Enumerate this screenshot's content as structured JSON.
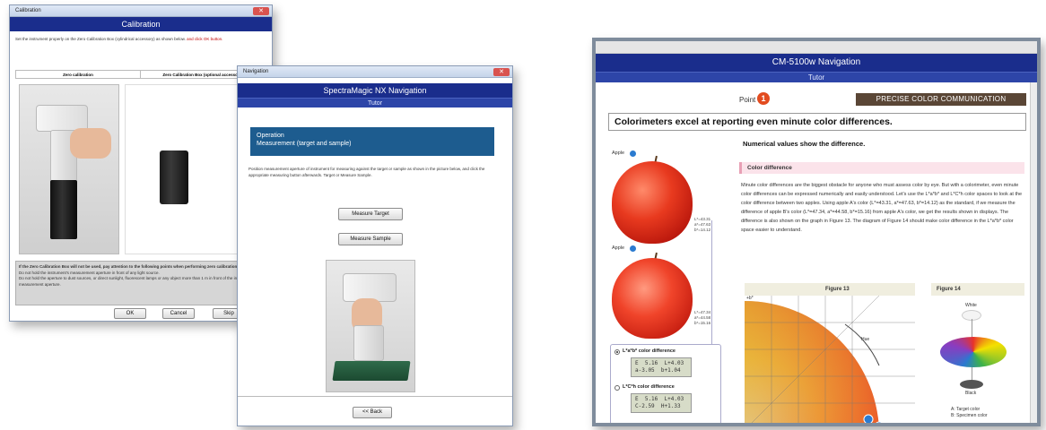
{
  "calibration_window": {
    "title_bar": "Calibration",
    "banner": "Calibration",
    "instruction": "Set the instrument properly on the Zero Calibration Box (cylindrical accessory) as shown below.",
    "instruction_red": "and click OK button.",
    "col_headers": [
      "Zero calibration",
      "Zero Calibration Box (optional accessory)"
    ],
    "warning_title": "If the Zero Calibration Box will not be used, pay attention to the following points when performing zero calibration.",
    "warning_lines": [
      "Do not hold the instrument's measurement aperture in front of any light source.",
      "Do not hold the aperture to dust sources, or direct sunlight, fluorescent lamps or any object more than 1 m in front of the instrument's measurement aperture."
    ],
    "buttons": {
      "ok": "OK",
      "cancel": "Cancel",
      "skip": "Skip"
    }
  },
  "navigation_window": {
    "title_bar": "Navigation",
    "banner": "SpectraMagic NX Navigation",
    "subbanner": "Tutor",
    "operation_title": "Operation",
    "operation_subtitle": "Measurement (target and sample)",
    "description": "Position measurement aperture of instrument for measuring against the target or sample as shown in the picture below, and click the appropriate measuring button afterwards. Target or Measure Sample.",
    "buttons": {
      "measure_target": "Measure Target",
      "measure_sample": "Measure Sample",
      "back": "<< Back"
    }
  },
  "cm_window": {
    "banner": "CM-5100w Navigation",
    "subbanner": "Tutor",
    "point_label": "Point",
    "point_number": "1",
    "precise_label": "PRECISE COLOR COMMUNICATION",
    "headline": "Colorimeters excel at reporting even minute color differences.",
    "numerical_heading": "Numerical values show the difference.",
    "section_title": "Color difference",
    "paragraph": "Minute color differences are the biggest obstacle for anyone who must assess color by eye. But with a colorimeter, even minute color differences can be expressed numerically and easily understood. Let's use the L*a*b* and L*C*h color spaces to look at the color difference between two apples. Using apple A's color (L*=43.31, a*=47.63, b*=14.12) as the standard, if we measure the difference of apple B's color (L*=47.34, a*=44.58, b*=15.16) from apple A's color, we get the results shown in displays. The difference is also shown on the graph in Figure 13. The diagram of Figure 14 should make color difference in the L*a*b* color space easier to understand.",
    "apple_a_label": "Apple",
    "apple_b_label": "Apple",
    "apple_a_values": [
      "L*=43.31",
      "a*=47.63",
      "b*=14.12"
    ],
    "apple_b_values": [
      "L*=47.34",
      "a*=44.58",
      "b*=15.16"
    ],
    "lab_diff_title": "L*a*b* color difference",
    "lab_diff_lines": [
      "E  5.16  L+4.03",
      "a-3.05  b+1.04"
    ],
    "lch_diff_title": "L*C*h color difference",
    "lch_diff_lines": [
      "E  5.16  L+4.03",
      "C-2.59  H+1.33"
    ],
    "figure13": "Figure 13",
    "figure14": "Figure 14",
    "chart_labels": {
      "y_axis": "+b*",
      "hue": "Hue",
      "white": "White",
      "black": "Black"
    },
    "legend": [
      "A: Target color",
      "B: Specimen color"
    ]
  },
  "colors": {
    "banner": "#1a2d8c",
    "operation_box": "#1d5c8f",
    "precise_box": "#5a4636",
    "point_badge": "#e24b1f",
    "section_bar": "#fbe3ea"
  }
}
